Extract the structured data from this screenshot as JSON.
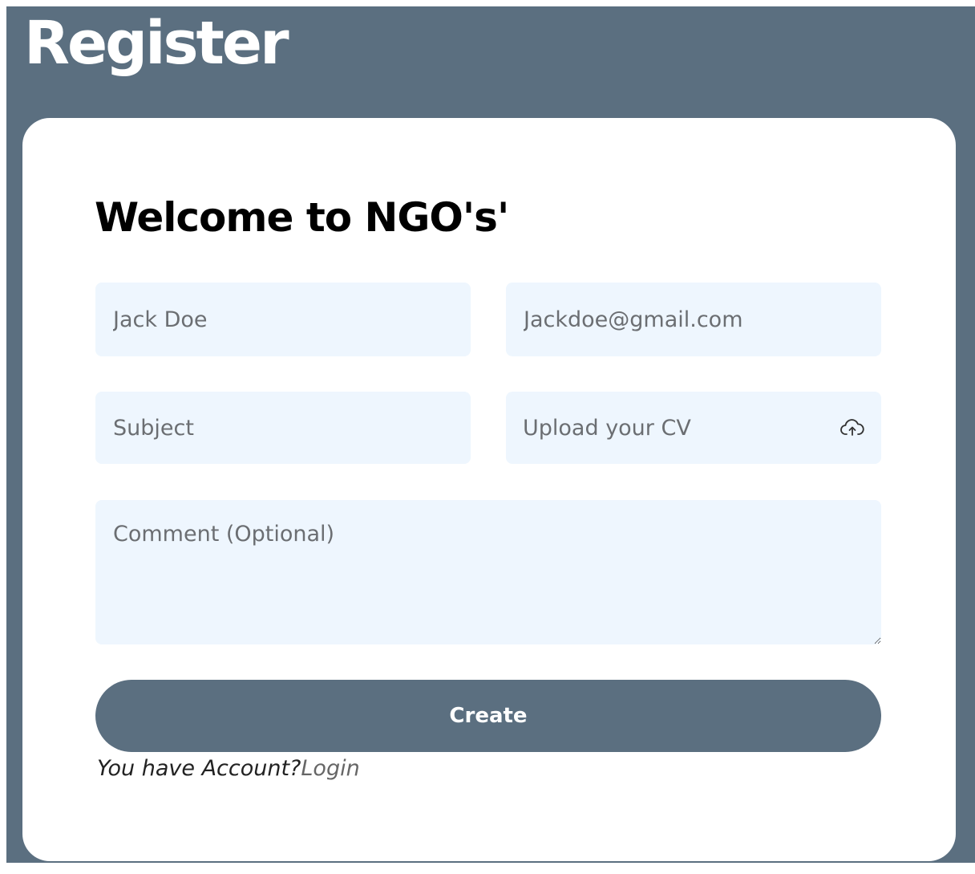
{
  "header": {
    "title": "Register"
  },
  "form": {
    "heading": "Welcome to NGO's'",
    "name_placeholder": "Jack Doe",
    "email_placeholder": "Jackdoe@gmail.com",
    "subject_placeholder": "Subject",
    "upload_label": "Upload your CV",
    "upload_icon": "cloud-upload-icon",
    "comment_placeholder": "Comment (Optional)",
    "submit_label": "Create",
    "account_prompt": "You have Account?",
    "login_label": "Login"
  },
  "colors": {
    "frame_bg": "#5b6f80",
    "card_bg": "#ffffff",
    "field_bg": "#eef6fe",
    "button_bg": "#5b6f80"
  }
}
